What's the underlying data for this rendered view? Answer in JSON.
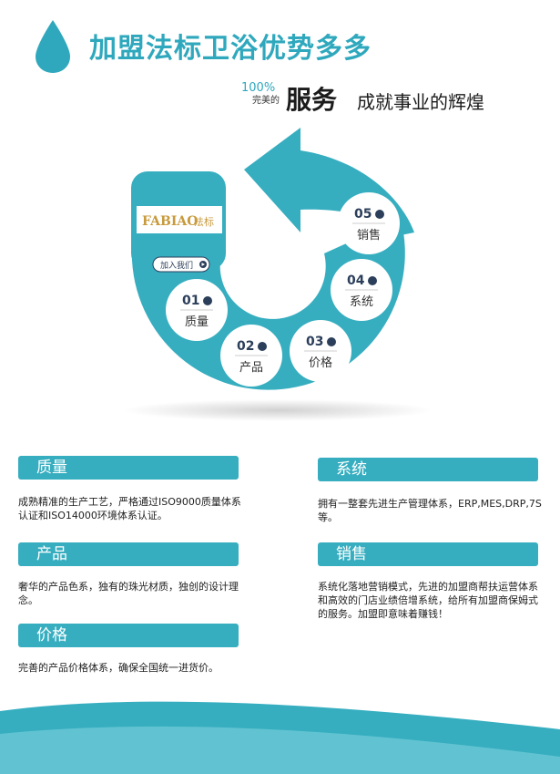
{
  "header": {
    "title": "加盟法标卫浴优势多多",
    "percent": "100%",
    "percent_sub": "完美的",
    "service": "服务",
    "slogan": "成就事业的辉煌"
  },
  "logo": {
    "brand": "FABIAO",
    "brand_cn": "法标",
    "join_button": "加入我们"
  },
  "steps": [
    {
      "num": "01",
      "label": "质量",
      "icon": "globe-icon"
    },
    {
      "num": "02",
      "label": "产品",
      "icon": "thumbs-up-icon"
    },
    {
      "num": "03",
      "label": "价格",
      "icon": "chat-icon"
    },
    {
      "num": "04",
      "label": "系统",
      "icon": "head-gear-icon"
    },
    {
      "num": "05",
      "label": "销售",
      "icon": "people-icon"
    }
  ],
  "cards": {
    "quality": {
      "title": "质量",
      "text": "成熟精准的生产工艺，严格通过ISO9000质量体系认证和ISO14000环境体系认证。"
    },
    "product": {
      "title": "产品",
      "text": "奢华的产品色系，独有的珠光材质，独创的设计理念。"
    },
    "price": {
      "title": "价格",
      "text": "完善的产品价格体系，确保全国统一进货价。"
    },
    "system": {
      "title": "系统",
      "text": "拥有一整套先进生产管理体系，ERP,MES,DRP,7S等。"
    },
    "sales": {
      "title": "销售",
      "text": "系统化落地营销模式，先进的加盟商帮扶运营体系和高效的门店业绩倍增系统，给所有加盟商保姆式的服务。加盟即意味着赚钱！"
    }
  },
  "colors": {
    "accent": "#36aec0",
    "dark": "#2b3e5a"
  }
}
